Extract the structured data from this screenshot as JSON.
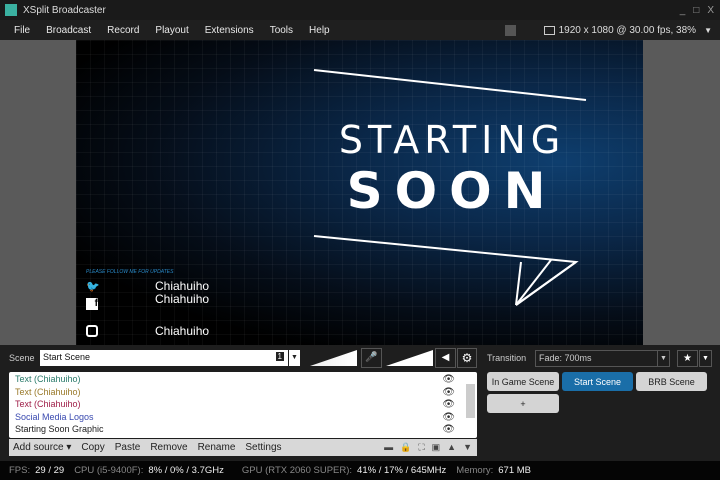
{
  "window": {
    "title": "XSplit Broadcaster",
    "minimize": "_",
    "maximize": "□",
    "close": "X"
  },
  "menu": [
    "File",
    "Broadcast",
    "Record",
    "Playout",
    "Extensions",
    "Tools",
    "Help"
  ],
  "resolution": "1920 x 1080 @ 30.00 fps, 38%",
  "canvas": {
    "line1": "STARTING",
    "line2": "SOON",
    "follow": "PLEASE FOLLOW ME FOR UPDATES",
    "twitter": "Chiahuiho",
    "facebook": "Chiahuiho",
    "instagram": "Chiahuiho"
  },
  "scene": {
    "label": "Scene",
    "value": "Start Scene",
    "number": "1"
  },
  "sources": [
    {
      "name": "Text (Chiahuiho)",
      "color": "#2a7a6a"
    },
    {
      "name": "Text (Chiahuiho)",
      "color": "#9a7a2a"
    },
    {
      "name": "Text (Chiahuiho)",
      "color": "#a0204a"
    },
    {
      "name": "Social Media Logos",
      "color": "#3a4ab0"
    },
    {
      "name": "Starting Soon Graphic",
      "color": "#222222"
    }
  ],
  "source_toolbar": {
    "add": "Add source ▾",
    "copy": "Copy",
    "paste": "Paste",
    "remove": "Remove",
    "rename": "Rename",
    "settings": "Settings"
  },
  "transition": {
    "label": "Transition",
    "value": "Fade: 700ms"
  },
  "scenes": [
    "In Game Scene",
    "Start Scene",
    "BRB Scene",
    "+"
  ],
  "accent": "#1a6ea8",
  "status": {
    "fps_label": "FPS:",
    "fps": "29 / 29",
    "cpu_label": "CPU (i5-9400F):",
    "cpu": "8% / 0% / 3.7GHz",
    "gpu_label": "GPU (RTX 2060 SUPER):",
    "gpu": "41% / 17% / 645MHz",
    "mem_label": "Memory:",
    "mem": "671 MB"
  }
}
